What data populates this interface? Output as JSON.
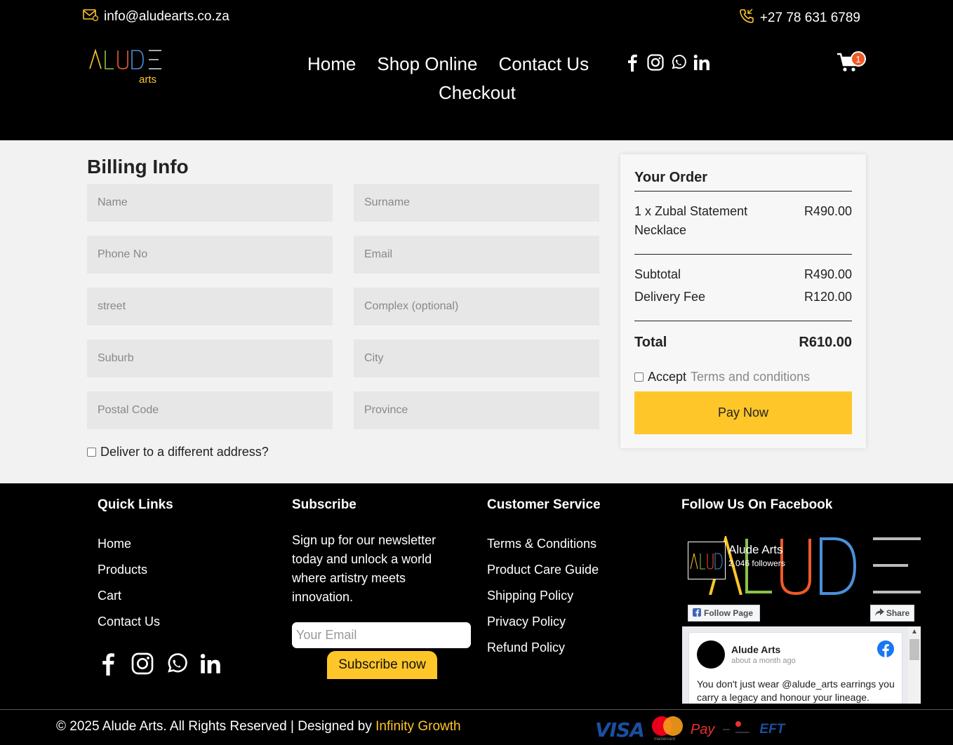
{
  "topbar": {
    "email": "info@aludearts.co.za",
    "phone": "+27 78 631 6789"
  },
  "logo": {
    "main": "ALUDE",
    "sub": "arts"
  },
  "nav": {
    "home": "Home",
    "shop": "Shop Online",
    "contact": "Contact Us",
    "checkout": "Checkout"
  },
  "cart": {
    "count": "1"
  },
  "billing": {
    "title": "Billing Info",
    "fields": {
      "name": "Name",
      "surname": "Surname",
      "phone": "Phone No",
      "email": "Email",
      "street": "street",
      "complex": "Complex (optional)",
      "suburb": "Suburb",
      "city": "City",
      "postal": "Postal Code",
      "province": "Province"
    },
    "deliver_label": "Deliver to a different address?"
  },
  "order": {
    "title": "Your Order",
    "item_label": "1 x Zubal Statement Necklace",
    "item_price": "R490.00",
    "subtotal_label": "Subtotal",
    "subtotal": "R490.00",
    "delivery_label": "Delivery Fee",
    "delivery": "R120.00",
    "total_label": "Total",
    "total": "R610.00",
    "accept_label": "Accept",
    "terms_label": "Terms and conditions",
    "pay_label": "Pay Now"
  },
  "footer": {
    "quick_title": "Quick Links",
    "quick_links": [
      "Home",
      "Products",
      "Cart",
      "Contact Us"
    ],
    "subscribe_title": "Subscribe",
    "subscribe_text": "Sign up for our newsletter today and unlock a world where artistry meets innovation.",
    "email_placeholder": "Your Email",
    "subscribe_btn": "Subscribe now",
    "cs_title": "Customer Service",
    "cs_links": [
      "Terms & Conditions",
      "Product Care Guide",
      "Shipping Policy",
      "Privacy Policy",
      "Refund Policy"
    ],
    "fb_title": "Follow Us On Facebook"
  },
  "facebook": {
    "page_name": "Alude Arts",
    "followers": "2,046 followers",
    "follow_label": "Follow Page",
    "share_label": "Share",
    "post_name": "Alude Arts",
    "post_time": "about a month ago",
    "post_text": "You don't just wear @alude_arts earrings you carry a legacy and honour your lineage."
  },
  "bottom": {
    "copyright": "© 2025 Alude Arts. All Rights Reserved | Designed by ",
    "designer": "Infinity Growth",
    "payment_visa": "VISA",
    "payment_mastercard": "mastercard",
    "payment_pay": "Pay",
    "payment_eft": "EFT"
  },
  "colors": {
    "accent": "#ffc629",
    "badge": "#f05a28",
    "background": "#000000",
    "panel": "#f2f2f2"
  }
}
